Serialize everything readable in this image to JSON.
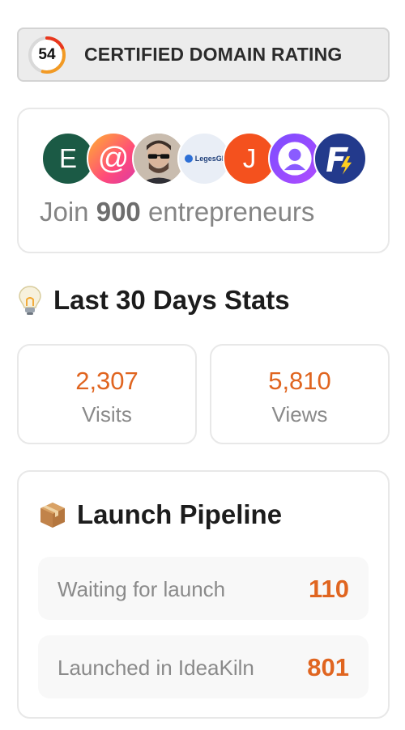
{
  "domain_rating": {
    "score": "54",
    "score_value": 54,
    "label": "CERTIFIED DOMAIN RATING"
  },
  "entrepreneurs": {
    "avatars": [
      {
        "letter": "E",
        "kind": "letter"
      },
      {
        "letter": "@",
        "kind": "at-symbol"
      },
      {
        "letter": "",
        "kind": "photo"
      },
      {
        "letter": "LegesGI",
        "kind": "logo"
      },
      {
        "letter": "J",
        "kind": "letter"
      },
      {
        "letter": "",
        "kind": "user-silhouette"
      },
      {
        "letter": "",
        "kind": "brand-logo"
      }
    ],
    "join_prefix": "Join",
    "join_count": "900",
    "join_suffix": "entrepreneurs"
  },
  "stats": {
    "title": "Last 30 Days Stats",
    "title_icon": "lightbulb-icon",
    "visits_value": "2,307",
    "visits_label": "Visits",
    "views_value": "5,810",
    "views_label": "Views"
  },
  "pipeline": {
    "title": "Launch Pipeline",
    "title_icon": "package-icon",
    "rows": [
      {
        "label": "Waiting for launch",
        "value": "110"
      },
      {
        "label": "Launched in IdeaKiln",
        "value": "801"
      }
    ]
  },
  "colors": {
    "accent": "#e06520",
    "muted_text": "#8a8a8a",
    "card_border": "#e8e8e8"
  }
}
